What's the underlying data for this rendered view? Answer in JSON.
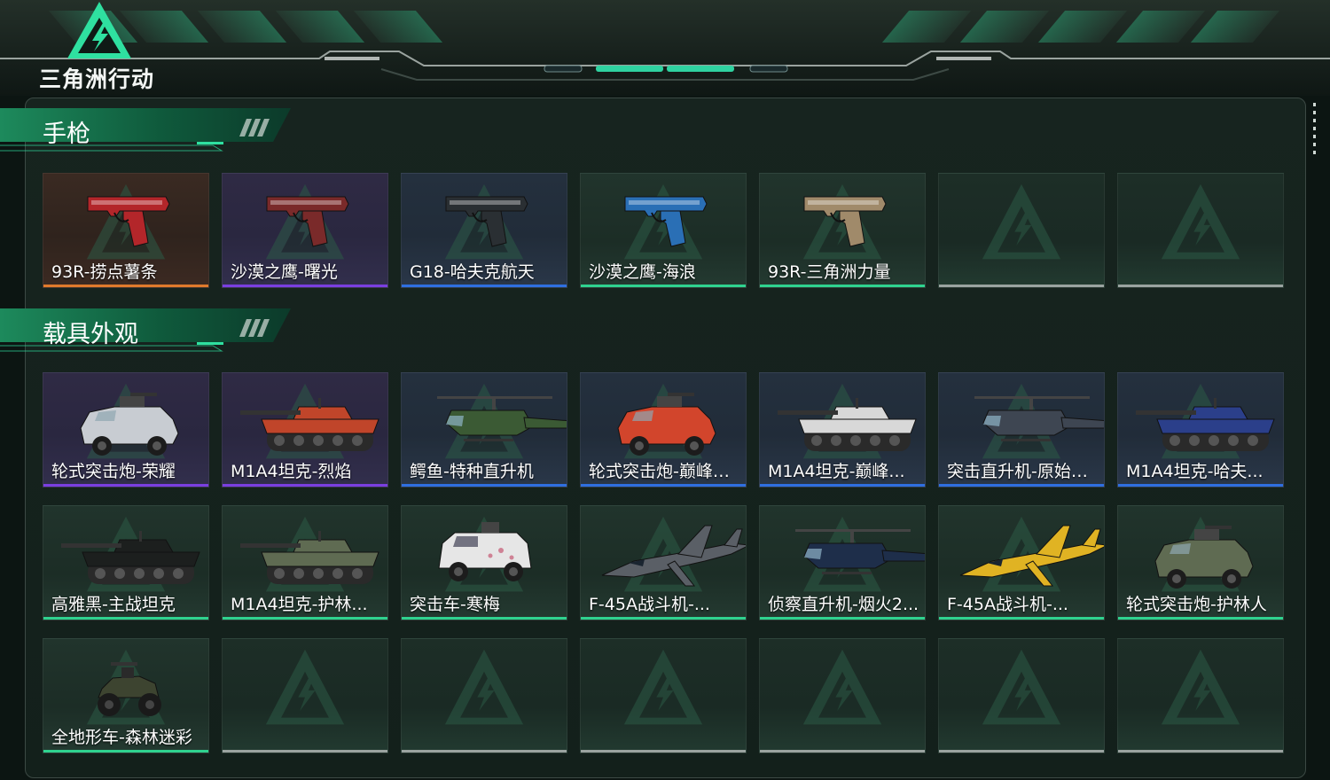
{
  "app": {
    "logo_text": "三角洲行动",
    "logo_icon": "delta-triangle-logo-icon"
  },
  "colors": {
    "accent": "#2fd28f",
    "rarity_orange": "#e07a2c",
    "rarity_purple": "#7a3fe0",
    "rarity_blue": "#2f6fe0",
    "rarity_green": "#2fd28f",
    "rarity_empty": "#9aa3a0"
  },
  "sections": [
    {
      "title": "手枪",
      "items": [
        {
          "label": "93R-捞点薯条",
          "rarity": "orange",
          "icon": "pistol-icon",
          "tint": "#b3262a"
        },
        {
          "label": "沙漠之鹰-曙光",
          "rarity": "purple",
          "icon": "pistol-icon",
          "tint": "#7a2a2a"
        },
        {
          "label": "G18-哈夫克航天",
          "rarity": "blue",
          "icon": "pistol-icon",
          "tint": "#2a2f33"
        },
        {
          "label": "沙漠之鹰-海浪",
          "rarity": "green",
          "icon": "pistol-icon",
          "tint": "#2a6fb5"
        },
        {
          "label": "93R-三角洲力量",
          "rarity": "green",
          "icon": "pistol-icon",
          "tint": "#a08a6a"
        },
        {
          "label": "",
          "rarity": "empty",
          "icon": "empty-slot-icon"
        },
        {
          "label": "",
          "rarity": "empty",
          "icon": "empty-slot-icon"
        }
      ]
    },
    {
      "title": "载具外观",
      "items": [
        {
          "label": "轮式突击炮-荣耀",
          "rarity": "purple",
          "icon": "armored-car-icon",
          "tint": "#c8ccd2"
        },
        {
          "label": "M1A4坦克-烈焰",
          "rarity": "purple",
          "icon": "tank-icon",
          "tint": "#c0452a"
        },
        {
          "label": "鳄鱼-特种直升机",
          "rarity": "blue",
          "icon": "helicopter-icon",
          "tint": "#3b5a34"
        },
        {
          "label": "轮式突击炮-巅峰竞...",
          "rarity": "blue",
          "icon": "armored-car-icon",
          "tint": "#d2452c"
        },
        {
          "label": "M1A4坦克-巅峰...",
          "rarity": "blue",
          "icon": "tank-icon",
          "tint": "#d8d8d8"
        },
        {
          "label": "突击直升机-原始伪...",
          "rarity": "blue",
          "icon": "helicopter-icon",
          "tint": "#3e4652"
        },
        {
          "label": "M1A4坦克-哈夫...",
          "rarity": "blue",
          "icon": "tank-icon",
          "tint": "#2b3f8a"
        },
        {
          "label": "高雅黑-主战坦克",
          "rarity": "green",
          "icon": "tank-icon",
          "tint": "#1c1f1e"
        },
        {
          "label": "M1A4坦克-护林...",
          "rarity": "green",
          "icon": "tank-icon",
          "tint": "#5f6b52"
        },
        {
          "label": "突击车-寒梅",
          "rarity": "green",
          "icon": "assault-vehicle-icon",
          "tint": "#e6e6e6"
        },
        {
          "label": "F-45A战斗机-...",
          "rarity": "green",
          "icon": "fighter-jet-icon",
          "tint": "#5a5f66"
        },
        {
          "label": "侦察直升机-烟火2...",
          "rarity": "green",
          "icon": "helicopter-icon",
          "tint": "#1e2e4a"
        },
        {
          "label": "F-45A战斗机-...",
          "rarity": "green",
          "icon": "fighter-jet-icon",
          "tint": "#e0b323"
        },
        {
          "label": "轮式突击炮-护林人",
          "rarity": "green",
          "icon": "armored-car-icon",
          "tint": "#5f6b52"
        },
        {
          "label": "全地形车-森林迷彩",
          "rarity": "green",
          "icon": "atv-icon",
          "tint": "#3d4430"
        },
        {
          "label": "",
          "rarity": "empty",
          "icon": "empty-slot-icon"
        },
        {
          "label": "",
          "rarity": "empty",
          "icon": "empty-slot-icon"
        },
        {
          "label": "",
          "rarity": "empty",
          "icon": "empty-slot-icon"
        },
        {
          "label": "",
          "rarity": "empty",
          "icon": "empty-slot-icon"
        },
        {
          "label": "",
          "rarity": "empty",
          "icon": "empty-slot-icon"
        },
        {
          "label": "",
          "rarity": "empty",
          "icon": "empty-slot-icon"
        }
      ]
    }
  ]
}
